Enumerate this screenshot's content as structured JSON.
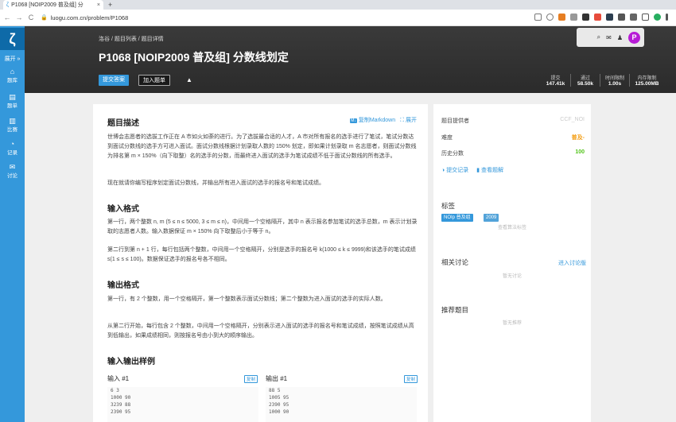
{
  "browser": {
    "tab_title": "P1068 [NOIP2009 普及组] 分",
    "tab_close": "×",
    "new_tab": "+",
    "url": "luogu.com.cn/problem/P1068",
    "back": "←",
    "forward": "→",
    "reload": "C"
  },
  "sidebar": {
    "logo": "ζ",
    "expand": "展开 »",
    "items": [
      {
        "icon": "⌂",
        "label": "题库"
      },
      {
        "icon": "▤",
        "label": "题单"
      },
      {
        "icon": "▥",
        "label": "比赛"
      },
      {
        "icon": "◔",
        "label": "记录"
      },
      {
        "icon": "✉",
        "label": "讨论"
      }
    ]
  },
  "header": {
    "breadcrumb": "洛谷 / 题目列表 / 题目详情",
    "title": "P1068 [NOIP2009 普及组] 分数线划定",
    "submit_label": "提交答案",
    "addset_label": "加入题单",
    "stats": [
      {
        "label": "提交",
        "value": "147.41k"
      },
      {
        "label": "通过",
        "value": "58.50k"
      },
      {
        "label": "时间限制",
        "value": "1.00s"
      },
      {
        "label": "内存限制",
        "value": "125.00MB"
      }
    ],
    "avatar_letter": "P"
  },
  "main": {
    "desc_title": "题目描述",
    "copy_md": "复制Markdown",
    "expand": "展开",
    "desc_p1": "世博会志愿者的选拔工作正在 A 市如火如荼的进行。为了选拔最合适的人才，A 市对所有报名的选手进行了笔试，笔试分数达到面试分数线的选手方可进入面试。面试分数线根据计划录取人数的 150% 划定，即如果计划录取 m 名志愿者，则面试分数线为排名第 m × 150%（向下取整）名的选手的分数，而最终进入面试的选手为笔试成绩不低于面试分数线的所有选手。",
    "desc_p2": "现在就请你编写程序划定面试分数线，并输出所有进入面试的选手的报名号和笔试成绩。",
    "in_title": "输入格式",
    "in_p1": "第一行，两个整数 n, m (5 ≤ n ≤ 5000, 3 ≤ m ≤ n)，中间用一个空格隔开，其中 n 表示报名参加笔试的选手总数，m 表示计划录取的志愿者人数。输入数据保证 m × 150% 向下取整后小于等于 n。",
    "in_p2": "第二行到第 n + 1 行，每行包括两个整数，中间用一个空格隔开，分别是选手的报名号 k(1000 ≤ k ≤ 9999)和该选手的笔试成绩 s(1 ≤ s ≤ 100)。数据保证选手的报名号各不相同。",
    "out_title": "输出格式",
    "out_p1": "第一行，有 2 个整数，用一个空格隔开，第一个整数表示面试分数线；第二个整数为进入面试的选手的实际人数。",
    "out_p2": "从第二行开始，每行包含 2 个整数，中间用一个空格隔开，分别表示进入面试的选手的报名号和笔试成绩，按照笔试成绩从高到低输出，如果成绩相同，则按报名号由小到大的顺序输出。",
    "sample_title": "输入输出样例",
    "input_label": "输入 #1",
    "output_label": "输出 #1",
    "copy_label": "复制",
    "input_lines": [
      "6 3",
      "1000 90",
      "3239 88",
      "2390 95"
    ],
    "output_lines": [
      "88 5",
      "1005 95",
      "2390 95",
      "1000 90"
    ]
  },
  "side": {
    "provider_label": "题目提供者",
    "provider_value": "CCF_NOI",
    "difficulty_label": "难度",
    "difficulty_value": "普及-",
    "history_label": "历史分数",
    "history_value": "100",
    "submissions_link": "提交记录",
    "solutions_link": "查看题解",
    "tags_title": "标签",
    "tags": [
      "NOIp 普及组",
      "2009"
    ],
    "tags_hint": "查看算法标签",
    "discuss_title": "相关讨论",
    "discuss_link": "进入讨论版",
    "discuss_empty": "暂无讨论",
    "recommend_title": "推荐题目",
    "recommend_empty": "暂无推荐"
  },
  "colors": {
    "accent": "#3498db",
    "difficulty": "#f39c11",
    "score": "#52c41a",
    "tag_blue": "#3498db",
    "tag_purple": "#52a3d9"
  }
}
